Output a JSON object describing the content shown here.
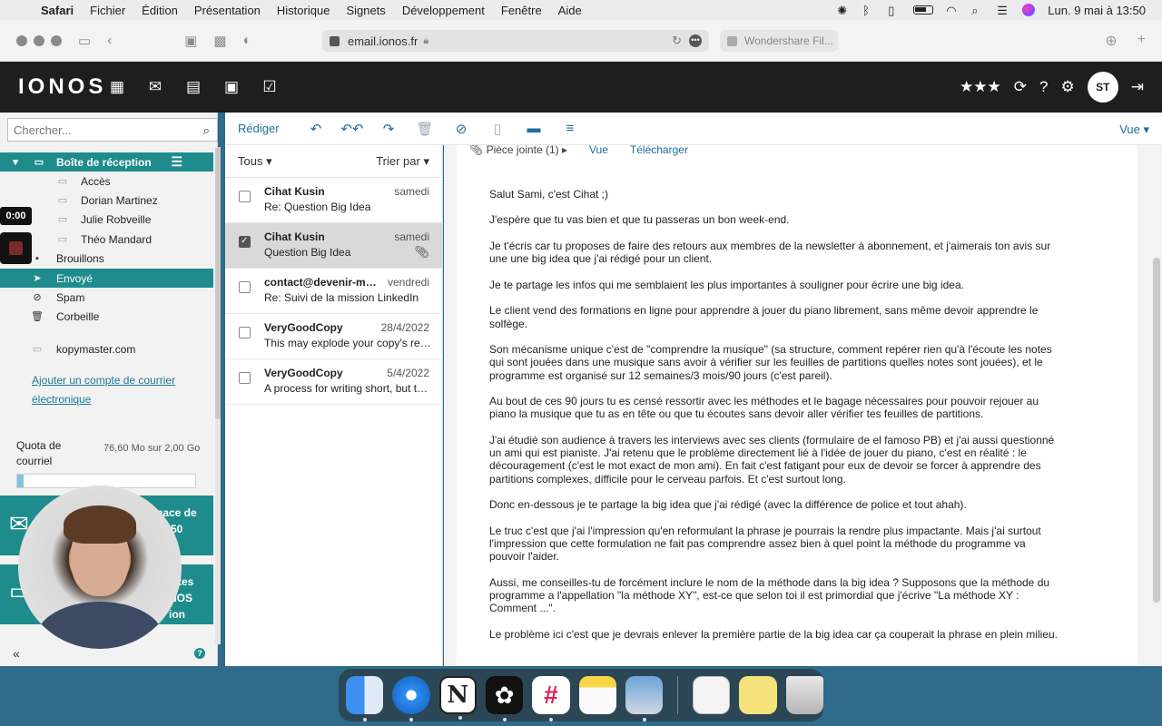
{
  "menubar": {
    "app": "Safari",
    "items": [
      "Fichier",
      "Édition",
      "Présentation",
      "Historique",
      "Signets",
      "Développement",
      "Fenêtre",
      "Aide"
    ],
    "datetime": "Lun. 9 mai à 13:50"
  },
  "browser": {
    "url": "email.ionos.fr",
    "second_tab": "Wondershare Fil..."
  },
  "header": {
    "logo": "IONOS",
    "avatar_initials": "ST"
  },
  "sidebar": {
    "search_placeholder": "Chercher...",
    "inbox": "Boîte de réception",
    "subfolders": [
      "Accès",
      "Dorian Martinez",
      "Julie Robveille",
      "Théo Mandard"
    ],
    "folders": {
      "drafts": "Brouillons",
      "sent": "Envoyé",
      "spam": "Spam",
      "trash": "Corbeille"
    },
    "external_account": "kopymaster.com",
    "add_account_line1": "Ajouter un compte de courrier",
    "add_account_line2": "électronique",
    "quota_label_1": "Quota de",
    "quota_label_2": "courriel",
    "quota_value": "76,60 Mo sur 2,00 Go",
    "quota_fraction": 0.037,
    "promo1_line1": "pace de",
    "promo1_line2": "à 50",
    "promo2_line1": "tes",
    "promo2_line2": "NOS",
    "promo2_line3": "ion"
  },
  "overlay": {
    "timer": "0:00"
  },
  "toolbar": {
    "compose": "Rédiger",
    "view": "Vue"
  },
  "list": {
    "filter": "Tous",
    "sort": "Trier par",
    "messages": [
      {
        "from": "Cihat Kusin",
        "date": "samedi",
        "subject": "Re: Question Big Idea"
      },
      {
        "from": "Cihat Kusin",
        "date": "samedi",
        "subject": "Question Big Idea"
      },
      {
        "from": "contact@devenir-mei...",
        "date": "vendredi",
        "subject": "Re: Suivi de la mission LinkedIn"
      },
      {
        "from": "VeryGoodCopy",
        "date": "28/4/2022",
        "subject": "This may explode your copy's res..."
      },
      {
        "from": "VeryGoodCopy",
        "date": "5/4/2022",
        "subject": "A process for writing short, but th..."
      }
    ]
  },
  "reader": {
    "attachment_label": "Pièce jointe (1)",
    "view_link": "Vue",
    "download_link": "Télécharger",
    "paragraphs": [
      "Salut Sami, c'est Cihat ;)",
      "J'espère que tu vas bien et que tu passeras un bon week-end.",
      "Je t'écris car tu proposes de faire des retours aux membres de la newsletter à abonnement, et j'aimerais ton avis sur une une big idea que j'ai rédigé pour un client.",
      "Je te partage les infos qui me semblaient les plus importantes à souligner pour écrire une big idea.",
      "Le client vend des formations en ligne pour apprendre à jouer du piano librement, sans même devoir apprendre le solfège.",
      "Son mécanisme unique c'est de \"comprendre la musique\" (sa structure, comment repérer rien qu'à l'écoute les notes qui sont jouées dans une musique sans avoir à vérifier sur les feuilles de partitions quelles notes sont jouées), et le programme est organisé sur 12 semaines/3 mois/90 jours (c'est pareil).",
      "Au bout de ces 90 jours tu es censé ressortir avec les méthodes et le bagage nécessaires pour pouvoir rejouer au piano la musique que tu as en tête ou que tu écoutes sans devoir aller vérifier tes feuilles de partitions.",
      "J'ai étudié son audience à travers les interviews avec ses clients (formulaire de el famoso PB) et j'ai aussi questionné un ami qui est pianiste. J'ai retenu que le problème directement lié à l'idée de jouer du piano, c'est en réalité : le découragement (c'est le mot exact de mon ami). En fait c'est fatigant pour eux de devoir se forcer à apprendre des partitions complexes, difficile pour le cerveau parfois. Et c'est surtout long.",
      "Donc en-dessous je te partage la big idea que j'ai rédigé (avec la différence de police et tout ahah).",
      "Le truc c'est que j'ai l'impression qu'en reformulant la phrase je pourrais la rendre plus impactante. Mais j'ai surtout l'impression que cette formulation ne fait pas comprendre assez bien à quel point la méthode du programme va pouvoir l'aider.",
      "Aussi, me conseilles-tu de forcément inclure le nom de la méthode dans la big idea ? Supposons que la méthode du programme a l'appellation \"la méthode XY\", est-ce que selon toi il est primordial que j'écrive \"La méthode XY : Comment ...\".",
      "Le problème ici c'est que je devrais enlever la première partie de la big idea car ça couperait la phrase en plein milieu."
    ]
  },
  "dock_apps": [
    "Finder",
    "Safari",
    "Notion",
    "ChatGPT",
    "Slack",
    "Notes",
    "Preview",
    "Document",
    "Stickies",
    "Trash"
  ]
}
